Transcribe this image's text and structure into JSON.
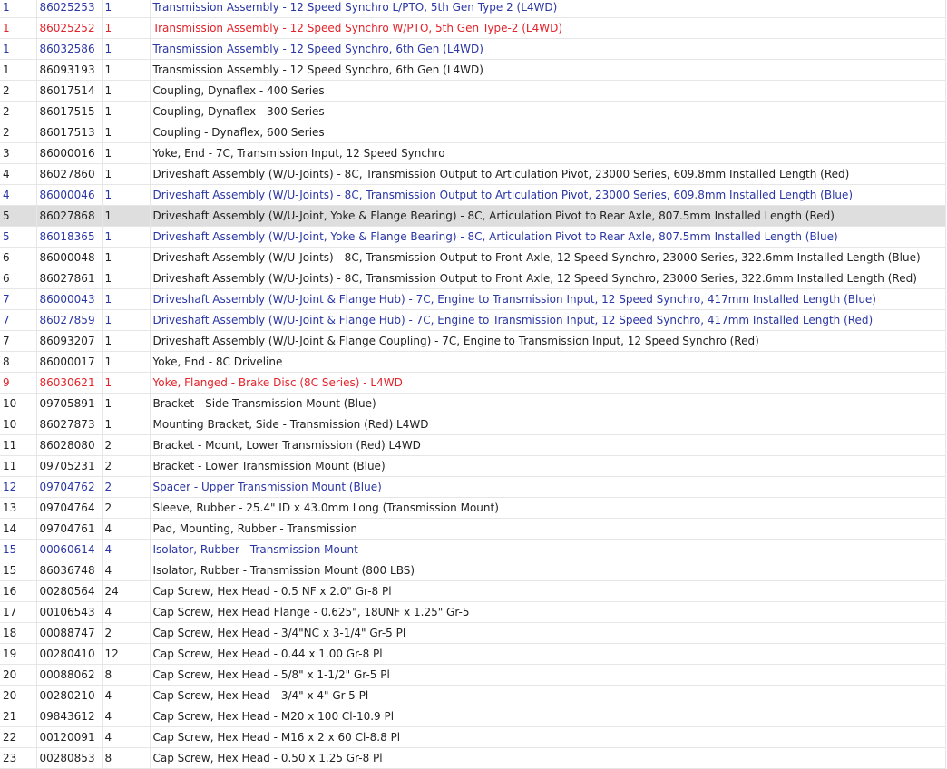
{
  "colors": {
    "link": "#2a36a4",
    "alert": "#e4222a",
    "text": "#222222",
    "highlight_row": "#dedede",
    "grid": "#e6e6e6"
  },
  "rows": [
    {
      "item": "1",
      "part": "86025253",
      "qty": "1",
      "desc": "Transmission Assembly - 12 Speed Synchro L/PTO, 5th Gen Type 2 (L4WD)",
      "style": "link"
    },
    {
      "item": "1",
      "part": "86025252",
      "qty": "1",
      "desc": "Transmission Assembly - 12 Speed Synchro W/PTO, 5th Gen Type-2 (L4WD)",
      "style": "alert"
    },
    {
      "item": "1",
      "part": "86032586",
      "qty": "1",
      "desc": "Transmission Assembly - 12 Speed Synchro, 6th Gen (L4WD)",
      "style": "link"
    },
    {
      "item": "1",
      "part": "86093193",
      "qty": "1",
      "desc": "Transmission Assembly - 12 Speed Synchro, 6th Gen (L4WD)",
      "style": "plain"
    },
    {
      "item": "2",
      "part": "86017514",
      "qty": "1",
      "desc": "Coupling, Dynaflex - 400 Series",
      "style": "plain"
    },
    {
      "item": "2",
      "part": "86017515",
      "qty": "1",
      "desc": "Coupling, Dynaflex - 300 Series",
      "style": "plain"
    },
    {
      "item": "2",
      "part": "86017513",
      "qty": "1",
      "desc": "Coupling - Dynaflex, 600 Series",
      "style": "plain"
    },
    {
      "item": "3",
      "part": "86000016",
      "qty": "1",
      "desc": "Yoke, End - 7C, Transmission Input, 12 Speed Synchro",
      "style": "plain"
    },
    {
      "item": "4",
      "part": "86027860",
      "qty": "1",
      "desc": "Driveshaft Assembly (W/U-Joints) - 8C, Transmission Output to Articulation Pivot, 23000 Series, 609.8mm Installed Length (Red)",
      "style": "plain"
    },
    {
      "item": "4",
      "part": "86000046",
      "qty": "1",
      "desc": "Driveshaft Assembly (W/U-Joints) - 8C, Transmission Output to Articulation Pivot, 23000 Series, 609.8mm Installed Length (Blue)",
      "style": "link"
    },
    {
      "item": "5",
      "part": "86027868",
      "qty": "1",
      "desc": "Driveshaft Assembly (W/U-Joint, Yoke & Flange Bearing) - 8C, Articulation Pivot to Rear Axle, 807.5mm Installed Length (Red)",
      "style": "highlight"
    },
    {
      "item": "5",
      "part": "86018365",
      "qty": "1",
      "desc": "Driveshaft Assembly (W/U-Joint, Yoke & Flange Bearing) - 8C, Articulation Pivot to Rear Axle, 807.5mm Installed Length (Blue)",
      "style": "link"
    },
    {
      "item": "6",
      "part": "86000048",
      "qty": "1",
      "desc": "Driveshaft Assembly (W/U-Joints) - 8C, Transmission Output to Front Axle, 12 Speed Synchro, 23000 Series, 322.6mm Installed Length (Blue)",
      "style": "plain"
    },
    {
      "item": "6",
      "part": "86027861",
      "qty": "1",
      "desc": "Driveshaft Assembly (W/U-Joints) - 8C, Transmission Output to Front Axle, 12 Speed Synchro, 23000 Series, 322.6mm Installed Length (Red)",
      "style": "plain"
    },
    {
      "item": "7",
      "part": "86000043",
      "qty": "1",
      "desc": "Driveshaft Assembly (W/U-Joint & Flange Hub) - 7C, Engine to Transmission Input, 12 Speed Synchro, 417mm Installed Length (Blue)",
      "style": "link"
    },
    {
      "item": "7",
      "part": "86027859",
      "qty": "1",
      "desc": "Driveshaft Assembly (W/U-Joint & Flange Hub) - 7C, Engine to Transmission Input, 12 Speed Synchro, 417mm Installed Length (Red)",
      "style": "link"
    },
    {
      "item": "7",
      "part": "86093207",
      "qty": "1",
      "desc": "Driveshaft Assembly (W/U-Joint & Flange Coupling) - 7C, Engine to Transmission Input, 12 Speed Synchro (Red)",
      "style": "plain"
    },
    {
      "item": "8",
      "part": "86000017",
      "qty": "1",
      "desc": "Yoke, End - 8C Driveline",
      "style": "plain"
    },
    {
      "item": "9",
      "part": "86030621",
      "qty": "1",
      "desc": "Yoke, Flanged - Brake Disc (8C Series) - L4WD",
      "style": "alert"
    },
    {
      "item": "10",
      "part": "09705891",
      "qty": "1",
      "desc": "Bracket - Side Transmission Mount (Blue)",
      "style": "plain"
    },
    {
      "item": "10",
      "part": "86027873",
      "qty": "1",
      "desc": "Mounting Bracket, Side - Transmission (Red) L4WD",
      "style": "plain"
    },
    {
      "item": "11",
      "part": "86028080",
      "qty": "2",
      "desc": "Bracket - Mount, Lower Transmission (Red) L4WD",
      "style": "plain"
    },
    {
      "item": "11",
      "part": "09705231",
      "qty": "2",
      "desc": "Bracket - Lower Transmission Mount (Blue)",
      "style": "plain"
    },
    {
      "item": "12",
      "part": "09704762",
      "qty": "2",
      "desc": "Spacer - Upper Transmission Mount (Blue)",
      "style": "link"
    },
    {
      "item": "13",
      "part": "09704764",
      "qty": "2",
      "desc": "Sleeve, Rubber - 25.4\" ID x 43.0mm Long (Transmission Mount)",
      "style": "plain"
    },
    {
      "item": "14",
      "part": "09704761",
      "qty": "4",
      "desc": "Pad, Mounting, Rubber - Transmission",
      "style": "plain"
    },
    {
      "item": "15",
      "part": "00060614",
      "qty": "4",
      "desc": "Isolator, Rubber - Transmission Mount",
      "style": "link"
    },
    {
      "item": "15",
      "part": "86036748",
      "qty": "4",
      "desc": "Isolator, Rubber - Transmission Mount (800 LBS)",
      "style": "plain"
    },
    {
      "item": "16",
      "part": "00280564",
      "qty": "24",
      "desc": "Cap Screw, Hex Head - 0.5 NF x 2.0\" Gr-8 Pl",
      "style": "plain"
    },
    {
      "item": "17",
      "part": "00106543",
      "qty": "4",
      "desc": "Cap Screw, Hex Head Flange - 0.625\", 18UNF x 1.25\" Gr-5",
      "style": "plain"
    },
    {
      "item": "18",
      "part": "00088747",
      "qty": "2",
      "desc": "Cap Screw, Hex Head - 3/4\"NC x 3-1/4\" Gr-5 Pl",
      "style": "plain"
    },
    {
      "item": "19",
      "part": "00280410",
      "qty": "12",
      "desc": "Cap Screw, Hex Head - 0.44 x 1.00 Gr-8 Pl",
      "style": "plain"
    },
    {
      "item": "20",
      "part": "00088062",
      "qty": "8",
      "desc": "Cap Screw, Hex Head - 5/8\" x 1-1/2\" Gr-5 Pl",
      "style": "plain"
    },
    {
      "item": "20",
      "part": "00280210",
      "qty": "4",
      "desc": "Cap Screw, Hex Head - 3/4\" x 4\" Gr-5 Pl",
      "style": "plain"
    },
    {
      "item": "21",
      "part": "09843612",
      "qty": "4",
      "desc": "Cap Screw, Hex Head - M20 x 100 Cl-10.9 Pl",
      "style": "plain"
    },
    {
      "item": "22",
      "part": "00120091",
      "qty": "4",
      "desc": "Cap Screw, Hex Head - M16 x 2 x 60 Cl-8.8 Pl",
      "style": "plain"
    },
    {
      "item": "23",
      "part": "00280853",
      "qty": "8",
      "desc": "Cap Screw, Hex Head - 0.50 x 1.25 Gr-8 Pl",
      "style": "plain"
    }
  ]
}
